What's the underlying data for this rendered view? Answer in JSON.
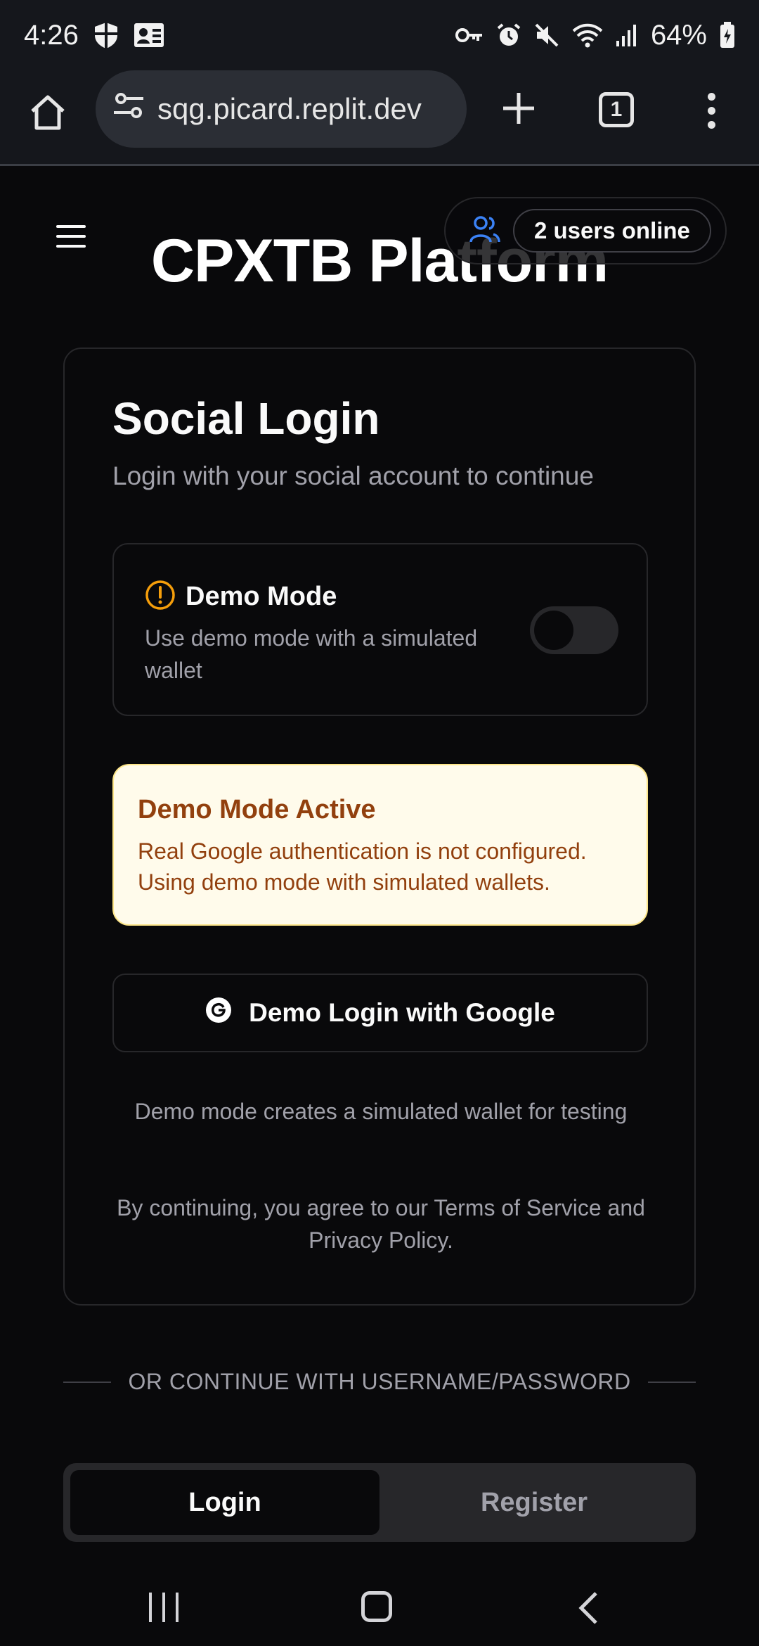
{
  "status_bar": {
    "time": "4:26",
    "battery": "64%",
    "icons": [
      "shield-icon",
      "contact-card-icon",
      "vpn-key-icon",
      "alarm-icon",
      "mute-icon",
      "wifi-icon",
      "signal-icon",
      "battery-icon"
    ]
  },
  "browser": {
    "url": "sqg.picard.replit.dev",
    "tab_count": "1"
  },
  "header": {
    "title": "CPXTB Platform",
    "online_users": "2 users online"
  },
  "card": {
    "title": "Social Login",
    "subtitle": "Login with your social account to continue",
    "demo_mode": {
      "title": "Demo Mode",
      "description": "Use demo mode with a simulated wallet",
      "enabled": false
    },
    "alert": {
      "title": "Demo Mode Active",
      "body": "Real Google authentication is not configured. Using demo mode with simulated wallets."
    },
    "google_button": "Demo Login with Google",
    "note": "Demo mode creates a simulated wallet for testing",
    "terms": "By continuing, you agree to our Terms of Service and Privacy Policy."
  },
  "divider": "OR CONTINUE WITH USERNAME/PASSWORD",
  "tabs": [
    {
      "label": "Login",
      "active": true
    },
    {
      "label": "Register",
      "active": false
    }
  ],
  "colors": {
    "background": "#09090b",
    "border": "#27272a",
    "muted_text": "#a1a1aa",
    "alert_bg": "#fffbeb",
    "alert_text": "#92400e",
    "warning_icon": "#f59e0b",
    "users_icon": "#3b82f6"
  }
}
